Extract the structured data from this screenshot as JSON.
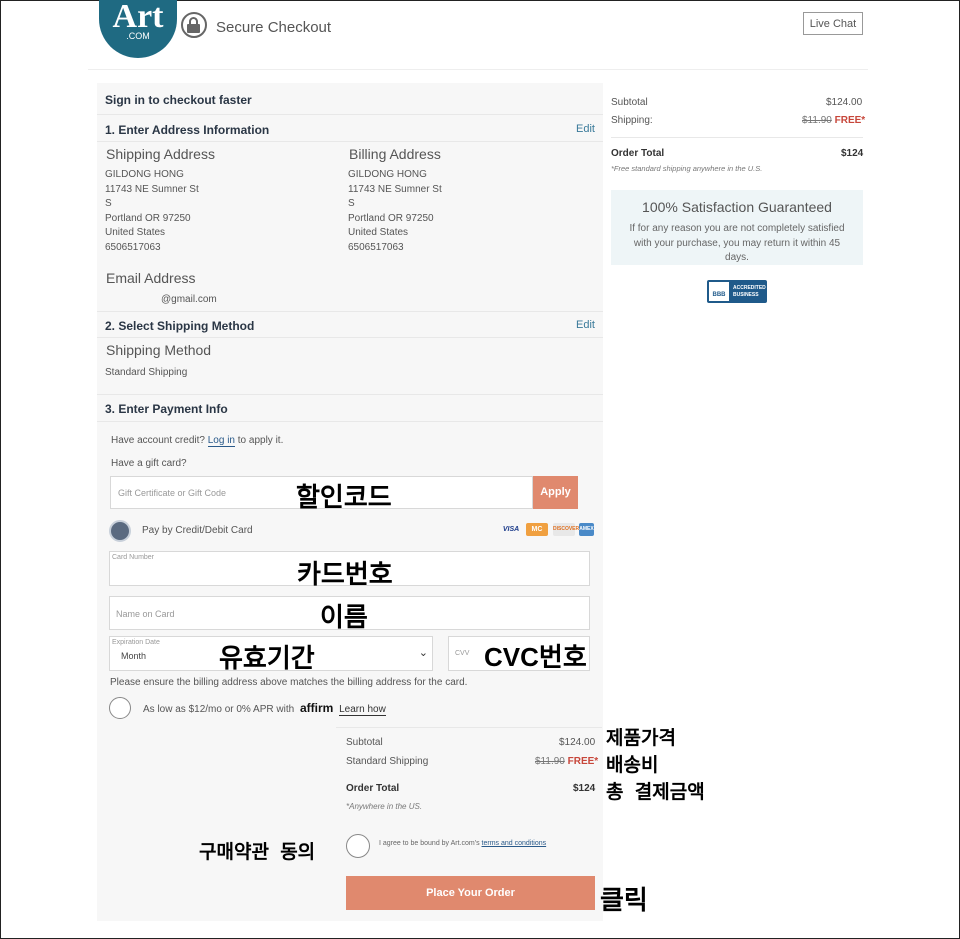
{
  "header": {
    "logo_main": "Art",
    "logo_sub": ".COM",
    "secure_checkout": "Secure Checkout",
    "live_chat": "Live Chat"
  },
  "sign_in": "Sign in to checkout faster",
  "step1": {
    "title": "1. Enter Address Information",
    "edit": "Edit",
    "shipping_title": "Shipping Address",
    "billing_title": "Billing Address",
    "shipping_lines": [
      "GILDONG HONG",
      "11743 NE Sumner St",
      "S",
      "Portland OR 97250",
      "United States",
      "6506517063"
    ],
    "billing_lines": [
      "GILDONG HONG",
      "11743 NE Sumner St",
      "S",
      "Portland OR 97250",
      "United States",
      "6506517063"
    ],
    "email_title": "Email Address",
    "email_value": "@gmail.com"
  },
  "step2": {
    "title": "2. Select Shipping Method",
    "edit": "Edit",
    "method_title": "Shipping Method",
    "method_value": "Standard Shipping"
  },
  "step3": {
    "title": "3. Enter Payment Info",
    "credit_prefix": "Have account credit?",
    "credit_link": "Log in",
    "credit_suffix": "to apply it.",
    "gift_label": "Have a gift card?",
    "gift_placeholder": "Gift Certificate or Gift Code",
    "apply": "Apply",
    "pay_card": "Pay by Credit/Debit Card",
    "card_logos": [
      "VISA",
      "MC",
      "DISCOVER",
      "AMEX"
    ],
    "card_number_label": "Card Number",
    "name_placeholder": "Name on Card",
    "exp_label": "Expiration Date",
    "exp_value": "Month",
    "cvv_placeholder": "CVV",
    "billing_note": "Please ensure the billing address above matches the billing address for the card.",
    "affirm_text": "As low as $12/mo or 0% APR with",
    "affirm_brand": "affirm",
    "affirm_link": "Learn how"
  },
  "order_summary_inline": {
    "subtotal_label": "Subtotal",
    "subtotal_value": "$124.00",
    "shipping_label": "Standard Shipping",
    "shipping_old": "$11.90",
    "shipping_free": "FREE*",
    "total_label": "Order Total",
    "total_value": "$124",
    "note": "*Anywhere in the US.",
    "agree_text": "I agree to be bound by Art.com's",
    "terms_link": "terms and conditions",
    "place_order": "Place Your Order"
  },
  "sidebar": {
    "subtotal_label": "Subtotal",
    "subtotal_value": "$124.00",
    "shipping_label": "Shipping:",
    "shipping_old": "$11.90",
    "shipping_free": "FREE*",
    "total_label": "Order Total",
    "total_value": "$124",
    "note": "*Free standard shipping anywhere in the U.S.",
    "guarantee_title": "100% Satisfaction Guaranteed",
    "guarantee_text": "If for any reason you are not completely satisfied with your purchase, you may return it within 45 days.",
    "bbb_label": "ACCREDITED BUSINESS"
  },
  "annotations": {
    "gift_code": "할인코드",
    "card_number": "카드번호",
    "name": "이름",
    "expiry": "유효기간",
    "cvc": "CVC번호",
    "product_price": "제품가격",
    "shipping_fee": "배송비",
    "total_payment": "총 결제금액",
    "terms_agree": "구매약관 동의",
    "click": "클릭"
  }
}
